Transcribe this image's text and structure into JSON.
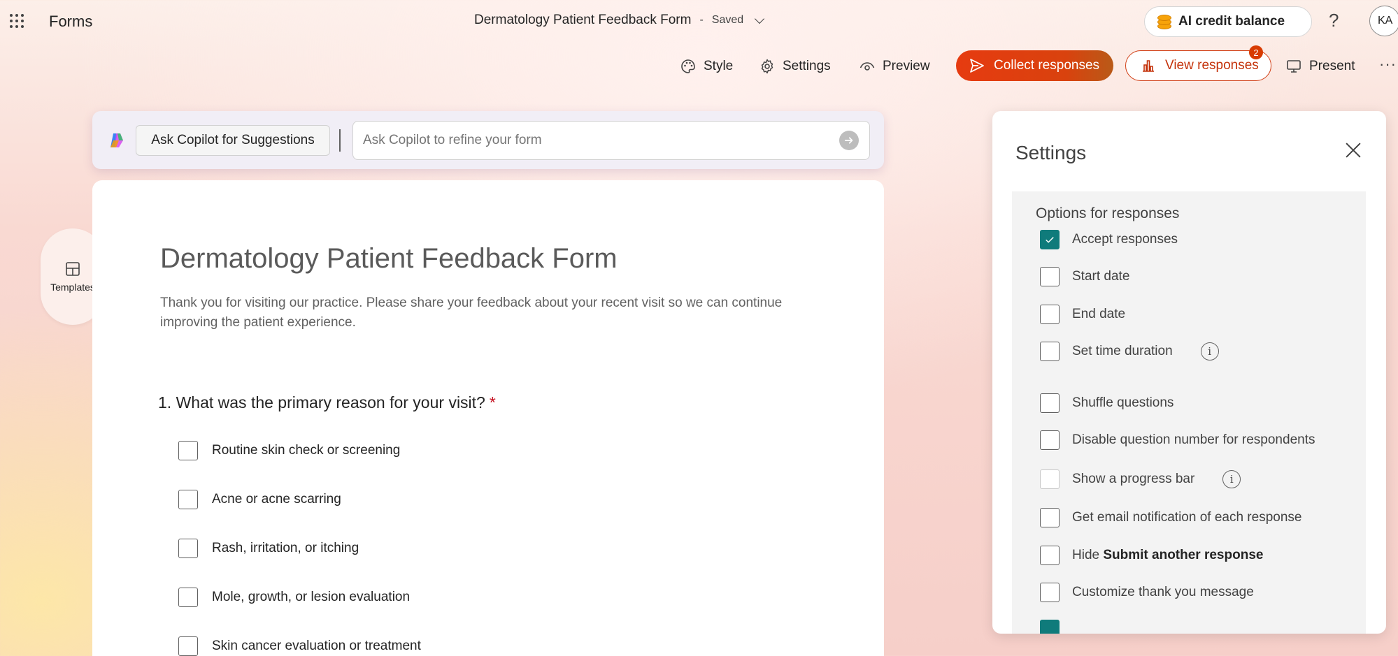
{
  "header": {
    "app_name": "Forms",
    "doc_title": "Dermatology Patient Feedback Form",
    "separator": "-",
    "save_status": "Saved",
    "credit_label": "AI credit balance",
    "help_label": "?",
    "avatar_initials": "KA"
  },
  "toolbar": {
    "style_label": "Style",
    "settings_label": "Settings",
    "preview_label": "Preview",
    "collect_label": "Collect responses",
    "view_label": "View responses",
    "view_badge": "2",
    "present_label": "Present",
    "more_label": "···"
  },
  "copilot": {
    "ask_label": "Ask Copilot for Suggestions",
    "input_placeholder": "Ask Copilot to refine your form"
  },
  "templates": {
    "label": "Templates"
  },
  "form": {
    "title": "Dermatology Patient Feedback Form",
    "description": "Thank you for visiting our practice. Please share your feedback about your recent visit so we can continue improving the patient experience.",
    "question": {
      "number": "1.",
      "text": "What was the primary reason for your visit?",
      "required_mark": "*",
      "options": [
        "Routine skin check or screening",
        "Acne or acne scarring",
        "Rash, irritation, or itching",
        "Mole, growth, or lesion evaluation",
        "Skin cancer evaluation or treatment"
      ]
    }
  },
  "settings": {
    "title": "Settings",
    "section_title": "Options for responses",
    "accept_responses": "Accept responses",
    "start_date": "Start date",
    "end_date": "End date",
    "set_time_duration": "Set time duration",
    "shuffle_questions": "Shuffle questions",
    "disable_question_number": "Disable question number for respondents",
    "show_progress_bar": "Show a progress bar",
    "email_notification": "Get email notification of each response",
    "hide_prefix": "Hide",
    "hide_bold": "Submit another response",
    "customize_thank_you": "Customize thank you message",
    "info_glyph": "i"
  },
  "colors": {
    "accent_teal": "#0f7b7b",
    "collect_orange": "#e63b10",
    "view_border": "#d13f16"
  }
}
